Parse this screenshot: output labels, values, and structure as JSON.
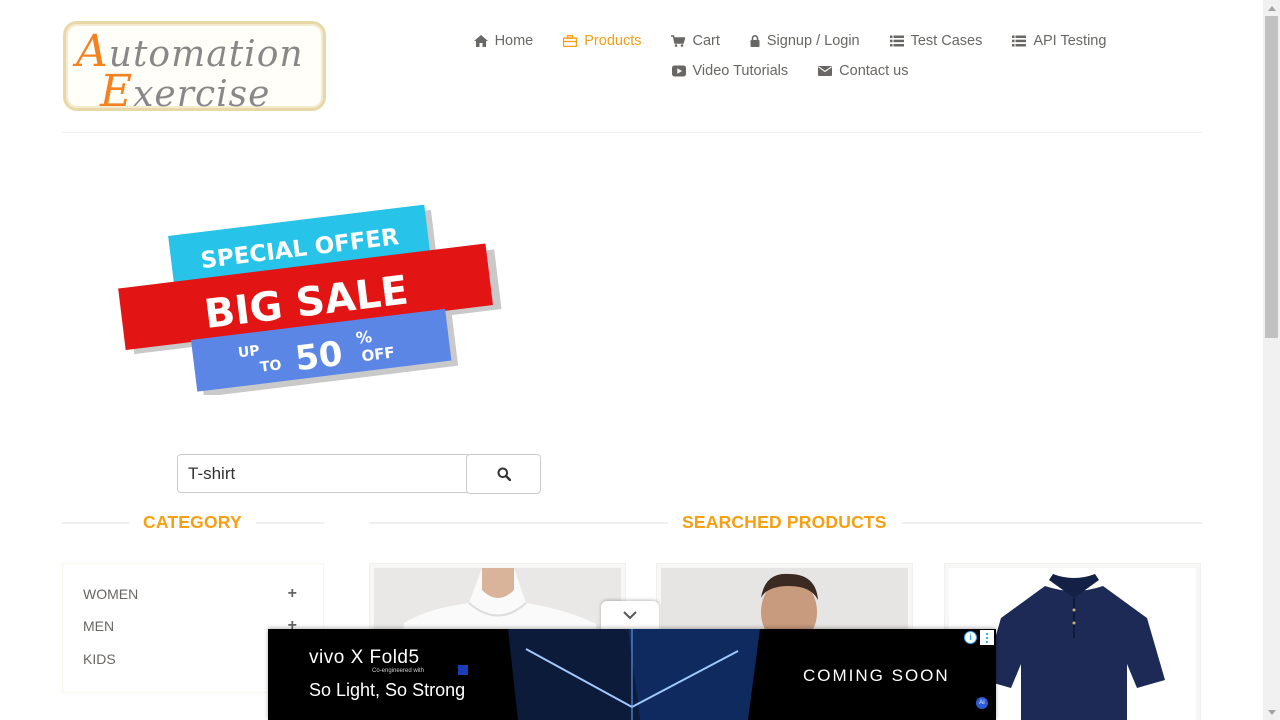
{
  "logo": {
    "line1_cap": "A",
    "line1_rest": "utomation",
    "line2_cap": "E",
    "line2_rest": "xercise"
  },
  "nav": {
    "row1": [
      {
        "label": "Home",
        "icon": "home-icon",
        "active": false
      },
      {
        "label": "Products",
        "icon": "briefcase-icon",
        "active": true
      },
      {
        "label": "Cart",
        "icon": "cart-icon",
        "active": false
      },
      {
        "label": "Signup / Login",
        "icon": "lock-icon",
        "active": false
      },
      {
        "label": "Test Cases",
        "icon": "list-icon",
        "active": false
      },
      {
        "label": "API Testing",
        "icon": "list-icon",
        "active": false
      }
    ],
    "row2": [
      {
        "label": "Video Tutorials",
        "icon": "youtube-play-icon",
        "active": false
      },
      {
        "label": "Contact us",
        "icon": "envelope-icon",
        "active": false
      }
    ]
  },
  "banner": {
    "top": "SPECIAL OFFER",
    "middle": "BIG SALE",
    "up": "UP",
    "to": "TO",
    "number": "50",
    "percent": "%",
    "off": "OFF"
  },
  "search": {
    "value": "T-shirt"
  },
  "sections": {
    "category": "CATEGORY",
    "products": "SEARCHED PRODUCTS"
  },
  "categories": [
    {
      "label": "WOMEN"
    },
    {
      "label": "MEN"
    },
    {
      "label": "KIDS"
    }
  ],
  "ad": {
    "brand": "vivo X Fold5",
    "coengineered": "Co-engineered with",
    "tagline": "So Light, So Strong",
    "cta": "COMING SOON",
    "info": "i",
    "ai_badge": "AI"
  },
  "colors": {
    "accent": "#f59f11",
    "text": "#696763",
    "logo_orange": "#f58220"
  }
}
